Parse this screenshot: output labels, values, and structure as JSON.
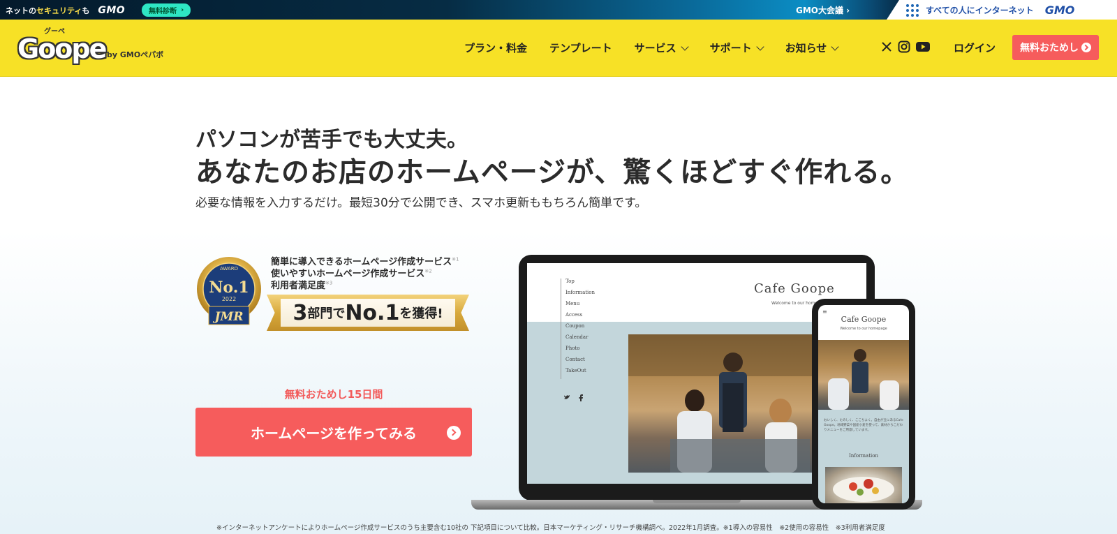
{
  "gmo_bar": {
    "net_prefix": "ネットの",
    "net_highlight": "セキュリティ",
    "net_suffix": "も",
    "gmo_logo": "GMO",
    "diagnosis_label": "無料診断",
    "conference_label": "GMO大会議 ›",
    "everyone_label": "すべての人にインターネット",
    "gmo_logo_right": "GMO"
  },
  "header": {
    "logo_kana": "グーペ",
    "logo_word": "Goope",
    "logo_by": "by GMOペパボ",
    "nav": [
      {
        "label": "プラン・料金",
        "dropdown": false
      },
      {
        "label": "テンプレート",
        "dropdown": false
      },
      {
        "label": "サービス",
        "dropdown": true
      },
      {
        "label": "サポート",
        "dropdown": true
      },
      {
        "label": "お知らせ",
        "dropdown": true
      }
    ],
    "login_label": "ログイン",
    "trial_label": "無料おためし"
  },
  "hero": {
    "line1": "パソコンが苦手でも大丈夫。",
    "line2": "あなたのお店のホームページが、驚くほどすぐ作れる。",
    "subtitle": "必要な情報を入力するだけ。最短30分で公開でき、スマホ更新ももちろん簡単です。"
  },
  "award": {
    "medal_top": "AWARD",
    "medal_no1": "No.1",
    "medal_year": "2022",
    "medal_org": "JMR",
    "lines": [
      {
        "text": "簡単に導入できるホームページ作成サービス",
        "mark": "※1"
      },
      {
        "text": "使いやすいホームページ作成サービス",
        "mark": "※2"
      },
      {
        "text": "利用者満足度",
        "mark": "※3"
      }
    ],
    "ribbon_num": "3",
    "ribbon_mid1": "部門で",
    "ribbon_no1": "No.1",
    "ribbon_mid2": "を獲得!"
  },
  "cta": {
    "label": "無料おためし15日間",
    "button": "ホームページを作ってみる"
  },
  "mockup": {
    "site_title": "Cafe Goope",
    "welcome": "Welcome to our homepage",
    "nav": [
      "Top",
      "Information",
      "Menu",
      "Access",
      "Coupon",
      "Calendar",
      "Photo",
      "Contact",
      "TakeOut"
    ],
    "phone_menu": "≡",
    "phone_para": "おいしく、たのしく、ここちよく。自由が丘にあるCafe Goope。地域野菜や国産小麦を使って、素材からこだわりメニューをご用意しています。",
    "phone_info": "Information"
  },
  "footnote": "※インターネットアンケートによりホームページ作成サービスのうち主要含む10社の 下記項目について比較。日本マーケティング・リサーチ機構調べ。2022年1月調査。※1導入の容易性　※2使用の容易性　※3利用者満足度",
  "colors": {
    "header_yellow": "#f7e126",
    "cta_red": "#f65c5c",
    "text_dark": "#2b2b2b",
    "mockup_blue": "#c3d6db"
  }
}
